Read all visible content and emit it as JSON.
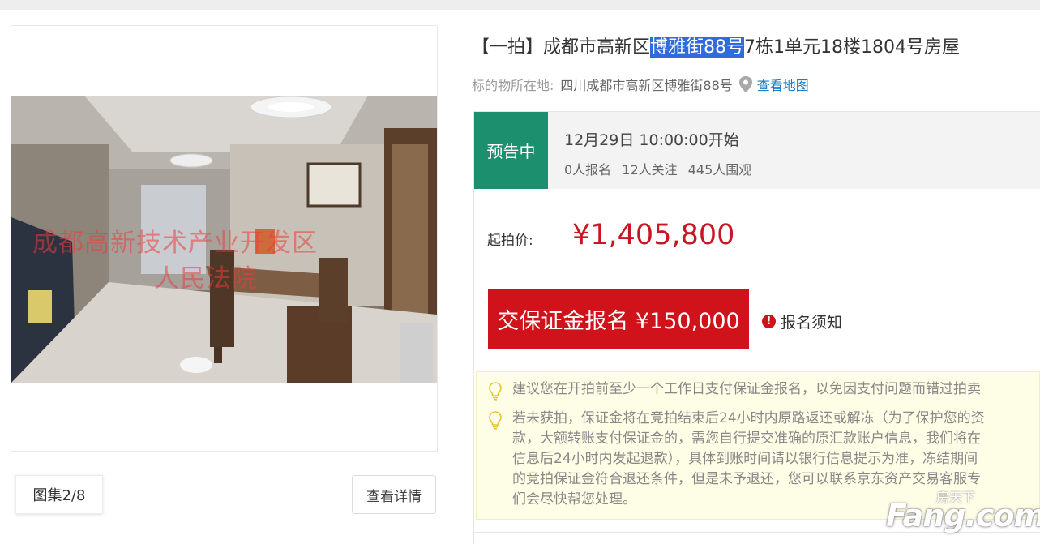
{
  "listing": {
    "title_prefix": "【一拍】成都市高新区",
    "title_highlight": "博雅街88号",
    "title_suffix": "7栋1单元18楼1804号房屋",
    "location_label": "标的物所在地:",
    "location_address": "四川成都市高新区博雅街88号",
    "map_link": "查看地图"
  },
  "gallery": {
    "watermark_line1": "成都高新技术产业开发区",
    "watermark_line2": "人民法院",
    "album_label": "图集2/8",
    "detail_button": "查看详情"
  },
  "auction": {
    "status": "预告中",
    "start_time": "12月29日 10:00:00开始",
    "registered": "0人报名",
    "followers": "12人关注",
    "watchers": "445人围观",
    "price_label": "起拍价:",
    "starting_price": "¥1,405,800",
    "deposit_button": "交保证金报名 ¥150,000",
    "notice_link": "报名须知"
  },
  "tips": {
    "tip1": "建议您在开拍前至少一个工作日支付保证金报名，以免因支付问题而错过拍卖",
    "tip2_lines": [
      "若未获拍，保证金将在竞拍结束后24小时内原路返还或解冻（为了保护您的资",
      "款，大额转账支付保证金的，需您自行提交准确的原汇款账户信息，我们将在",
      "信息后24小时内发起退款），具体到账时间请以银行信息提示为准，冻结期间",
      "的竞拍保证金符合退还条件，但是未予退还，您可以联系京东资产交易客服专",
      "们会尽快帮您处理。"
    ]
  },
  "logo": {
    "small_text": "房天下",
    "big_text": "Fang.com"
  },
  "colors": {
    "status_green": "#1b8f6e",
    "price_red": "#c81623",
    "button_red": "#d0121b",
    "link_blue": "#1a7ec3",
    "tips_bg": "#fefde6"
  },
  "icons": [
    "location-pin-icon",
    "exclamation-icon",
    "lightbulb-icon"
  ]
}
